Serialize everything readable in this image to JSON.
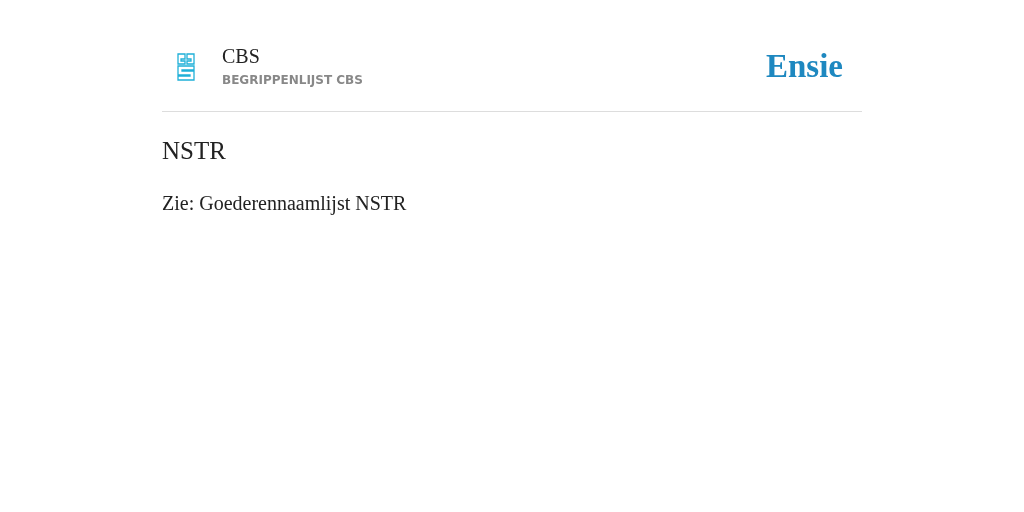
{
  "header": {
    "title": "CBS",
    "subtitle": "BEGRIPPENLIJST CBS",
    "brand": "Ensie"
  },
  "entry": {
    "term": "NSTR",
    "text": "Zie: Goederennaamlijst NSTR"
  }
}
